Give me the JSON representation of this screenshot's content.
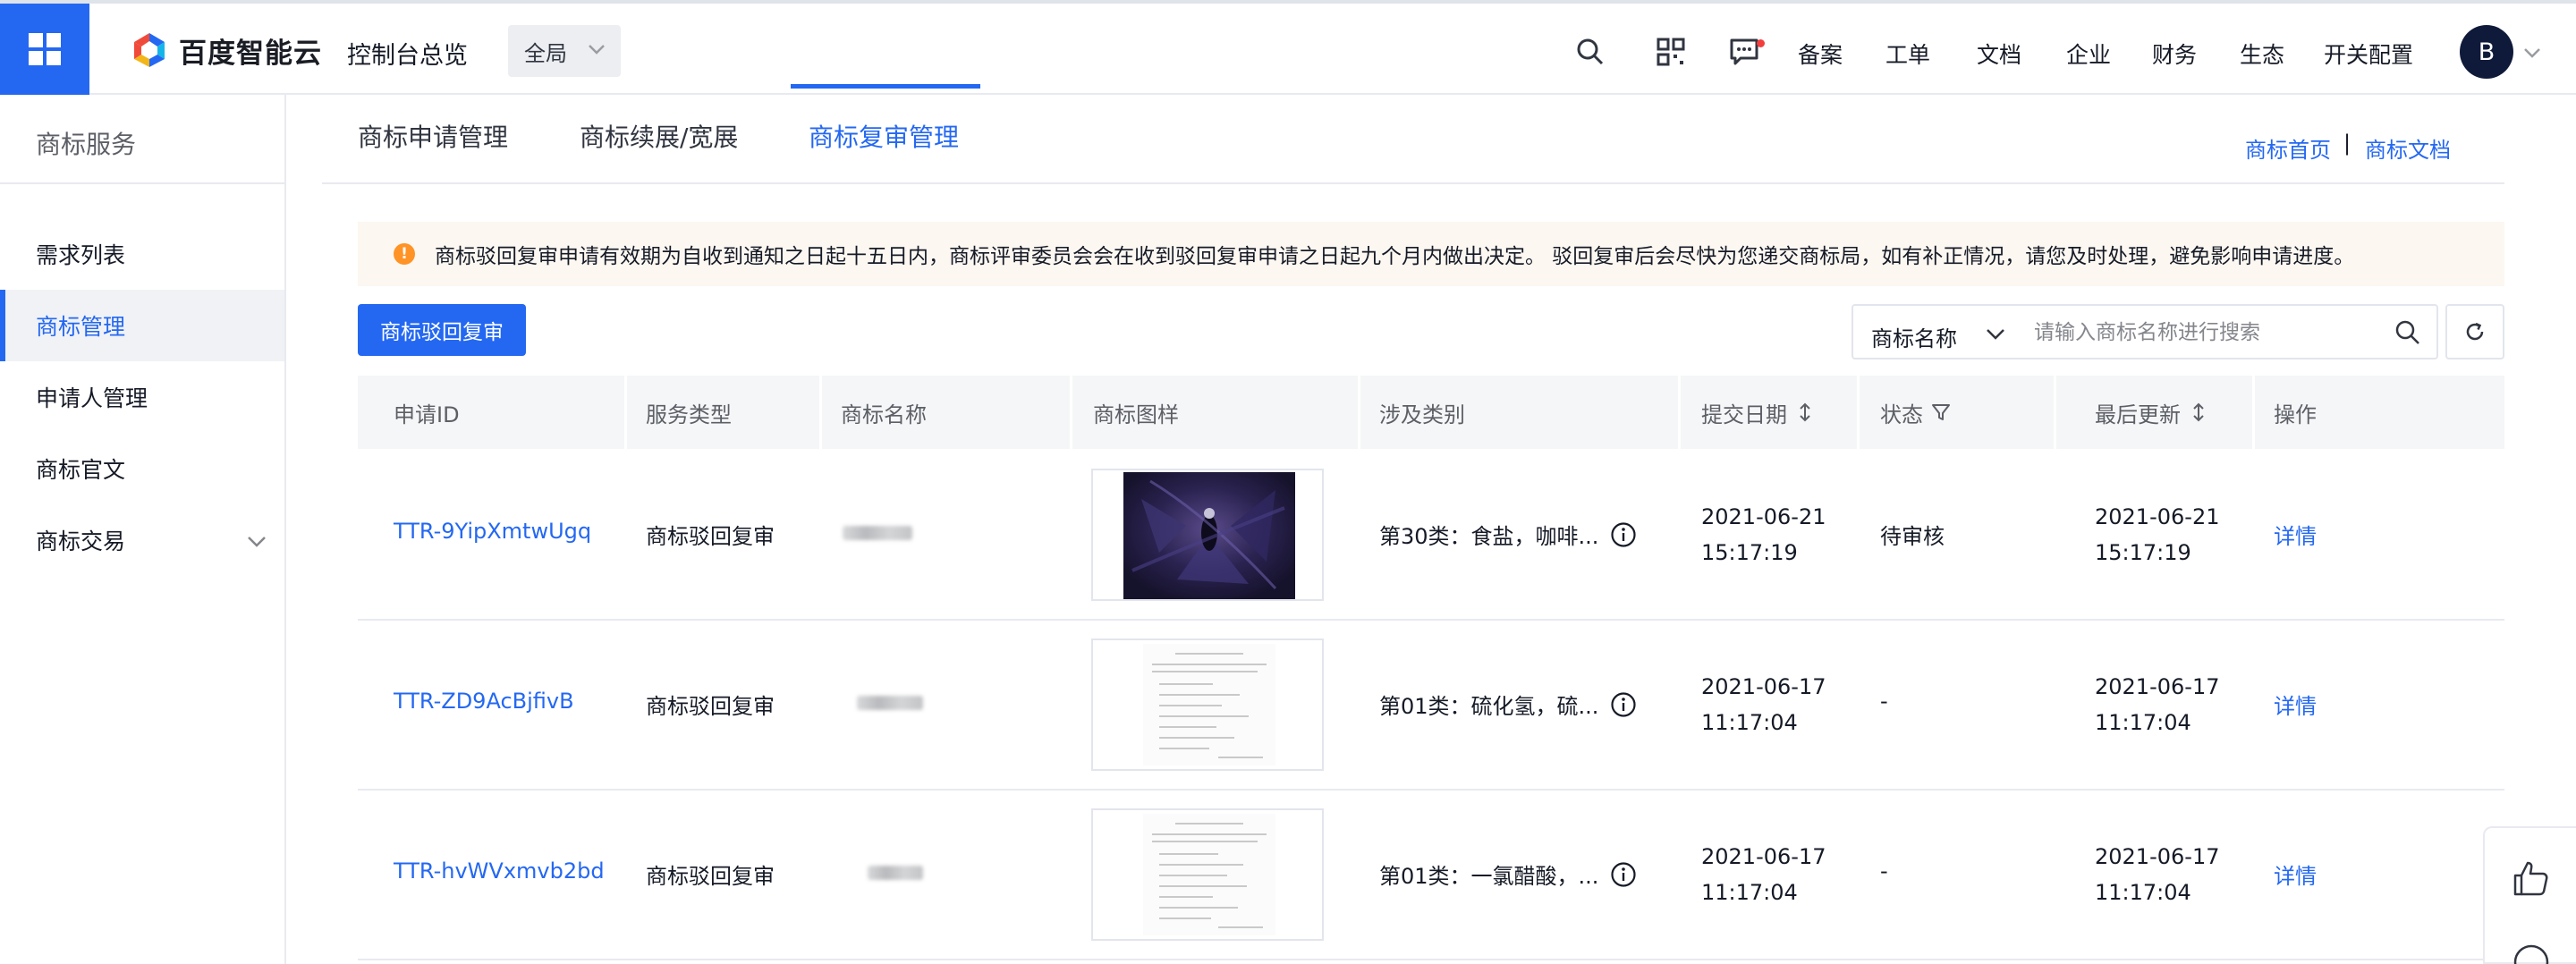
{
  "topbar": {
    "logo_text": "百度智能云",
    "console_title": "控制台总览",
    "region": "全局",
    "nav_links": [
      "备案",
      "工单",
      "文档",
      "企业",
      "财务",
      "生态",
      "开关配置"
    ],
    "avatar_letter": "B",
    "icons": [
      "search-icon",
      "qrcode-icon",
      "message-icon"
    ]
  },
  "sidebar": {
    "title": "商标服务",
    "items": [
      {
        "label": "需求列表"
      },
      {
        "label": "商标管理"
      },
      {
        "label": "申请人管理"
      },
      {
        "label": "商标官文"
      },
      {
        "label": "商标交易"
      }
    ],
    "active_item": "商标管理"
  },
  "tabs": {
    "items": [
      {
        "label": "商标申请管理"
      },
      {
        "label": "商标续展/宽展"
      },
      {
        "label": "商标复审管理"
      }
    ],
    "active": "商标复审管理",
    "links": {
      "home": "商标首页",
      "sep": "|",
      "docs": "商标文档"
    }
  },
  "notice": {
    "text": "商标驳回复审申请有效期为自收到通知之日起十五日内，商标评审委员会会在收到驳回复审申请之日起九个月内做出决定。 驳回复审后会尽快为您递交商标局，如有补正情况，请您及时处理，避免影响申请进度。"
  },
  "toolbar": {
    "primary_button": "商标驳回复审",
    "search_field": "商标名称",
    "search_placeholder": "请输入商标名称进行搜索"
  },
  "table": {
    "columns": [
      "申请ID",
      "服务类型",
      "商标名称",
      "商标图样",
      "涉及类别",
      "提交日期",
      "状态",
      "最后更新",
      "操作"
    ],
    "rows": [
      {
        "id": "TTR-9YipXmtwUgq",
        "service": "商标驳回复审",
        "category": "第30类：食盐，咖啡...",
        "submit_date": "2021-06-21",
        "submit_time": "15:17:19",
        "status": "待审核",
        "update_date": "2021-06-21",
        "update_time": "15:17:19",
        "action": "详情"
      },
      {
        "id": "TTR-ZD9AcBjfivB",
        "service": "商标驳回复审",
        "category": "第01类：硫化氢，硫...",
        "submit_date": "2021-06-17",
        "submit_time": "11:17:04",
        "status": "-",
        "update_date": "2021-06-17",
        "update_time": "11:17:04",
        "action": "详情"
      },
      {
        "id": "TTR-hvWVxmvb2bd",
        "service": "商标驳回复审",
        "category": "第01类：一氯醋酸，...",
        "submit_date": "2021-06-17",
        "submit_time": "11:17:04",
        "status": "-",
        "update_date": "2021-06-17",
        "update_time": "11:17:04",
        "action": "详情"
      }
    ]
  },
  "colors": {
    "primary": "#2468f2",
    "warning": "#ff9326",
    "notice_bg": "#fcf7f1"
  }
}
